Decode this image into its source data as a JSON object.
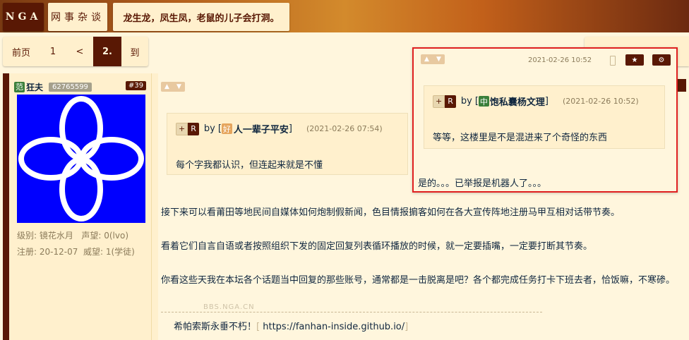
{
  "header": {
    "logo": "NGA",
    "forum": "网事杂谈",
    "thread_title": "龙生龙，凤生凤，老鼠的儿子会打洞。"
  },
  "pager": {
    "first": "前页",
    "page1": "1",
    "prev": "<",
    "current": "2.",
    "goto": "到"
  },
  "user": {
    "badge": "范",
    "name": "狂夫",
    "uid": "62765599",
    "floor": "#39",
    "level_label": "级别:",
    "level": "镜花水月",
    "prestige_label": "声望:",
    "prestige": "0(lvo)",
    "register_label": "注册:",
    "register": "20-12-07",
    "authority_label": "威望:",
    "authority": "1(学徒)"
  },
  "post": {
    "quote": {
      "plus": "+",
      "r": "R",
      "by": "by",
      "badge": "好",
      "name": "人一辈子平安",
      "date": "(2021-02-26 07:54)",
      "text": "每个字我都认识，但连起来就是不懂"
    },
    "paragraphs": [
      "接下来可以看莆田等地民间自媒体如何炮制假新闻，色目情报掮客如何在各大宣传阵地注册马甲互相对话带节奏。",
      "看着它们自言自语或者按照组织下发的固定回复列表循环播放的时候，就一定要插嘴，一定要打断其节奏。",
      "你看这些天我在本坛各个话题当中回复的那些账号，通常都是一击脱离是吧？各个都完成任务打卡下班去者，恰饭嘛，不寒碜。"
    ],
    "watermark": "BBS.NGA.CN",
    "signature": {
      "text": "希帕索斯永垂不朽！",
      "bracket_open": "[",
      "link": "https://fanhan-inside.github.io/",
      "bracket_close": "]"
    }
  },
  "popup": {
    "date": "2021-02-26 10:52",
    "star": "★",
    "gear": "⚙",
    "quote": {
      "plus": "+",
      "r": "R",
      "by": "by",
      "bracket_open": "[",
      "badge": "中",
      "name": "饱私囊杨文理",
      "bracket_close": "]",
      "date": "(2021-02-26 10:52)",
      "text": "等等，这楼里是不是混进来了个奇怪的东西"
    },
    "reply": "是的。。。已举报是机器人了。。。"
  },
  "colors": {
    "accent": "#591804",
    "background": "#fff6dd",
    "panel": "#fff0cd",
    "popup_border": "#e02020"
  }
}
